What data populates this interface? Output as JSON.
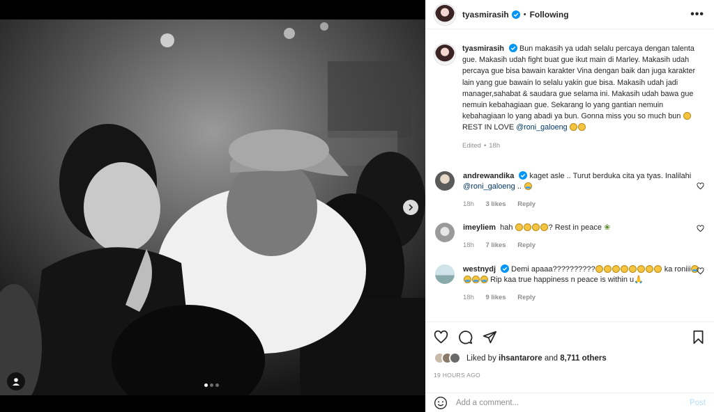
{
  "post": {
    "username": "tyasmirasih",
    "follow_status": "Following",
    "separator": "•",
    "more_label": "•••",
    "caption": {
      "text": "Bun makasih ya udah selalu percaya dengan talenta gue. Makasih udah fight buat gue ikut main di Marley. Makasih udah percaya gue bisa bawain karakter Vina dengan baik dan juga karakter lain yang gue bawain lo selalu yakin gue bisa. Makasih udah jadi manager,sahabat & saudara gue selama ini. Makasih udah bawa gue nemuin kebahagiaan gue. Sekarang lo yang gantian nemuin kebahagiaan lo yang abadi ya bun. Gonna miss you so much bun",
      "line2_prefix": "REST IN LOVE",
      "mention": "@roni_galoeng",
      "edited": "Edited",
      "age": "18h"
    },
    "carousel": {
      "total": 3,
      "active": 1
    }
  },
  "comments": [
    {
      "username": "andrewandika",
      "text_before": "kaget asle .. Turut berduka cita ya tyas. Inalilahi",
      "mention": "@roni_galoeng",
      "text_after": "..",
      "age": "18h",
      "likes": "3 likes",
      "reply": "Reply"
    },
    {
      "username": "imeyliem",
      "text_before": "hah",
      "text_after": "? Rest in peace",
      "age": "18h",
      "likes": "7 likes",
      "reply": "Reply"
    },
    {
      "username": "westnydj",
      "text_before": "Demi apaaa??????????",
      "text_mid": "ka roniii",
      "text_after": "Rip kaa true happiness n peace is within u",
      "age": "18h",
      "likes": "9 likes",
      "reply": "Reply"
    }
  ],
  "likes": {
    "prefix": "Liked by",
    "user": "ihsantarore",
    "conjunction": "and",
    "others": "8,711 others"
  },
  "timestamp": "19 HOURS AGO",
  "comment_box": {
    "placeholder": "Add a comment...",
    "post_label": "Post"
  },
  "colors": {
    "link": "#00376b",
    "verified": "#0095f6",
    "muted": "#8e8e8e",
    "post_disabled": "#b2dffc"
  },
  "icons": [
    "verified-badge-icon",
    "heart-icon",
    "comment-icon",
    "share-icon",
    "bookmark-icon",
    "emoji-icon",
    "chevron-right-icon",
    "user-tag-icon"
  ]
}
